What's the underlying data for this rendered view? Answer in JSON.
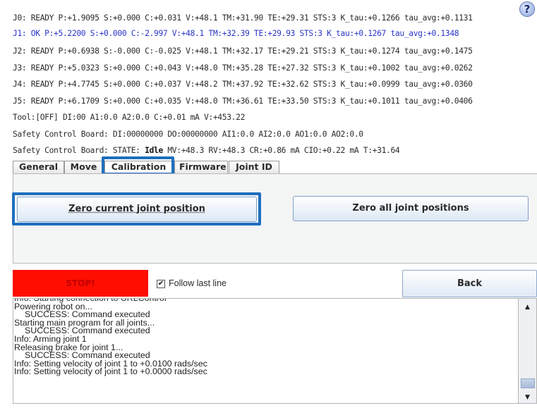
{
  "status": {
    "joints": [
      "J0: READY P:+1.9095 S:+0.000 C:+0.031 V:+48.1 TM:+31.90 TE:+29.31 STS:3 K_tau:+0.1266 tau_avg:+0.1131",
      "J1: OK P:+5.2200 S:+0.000 C:-2.997 V:+48.1 TM:+32.39 TE:+29.93 STS:3 K_tau:+0.1267 tau_avg:+0.1348",
      "J2: READY P:+0.6938 S:-0.000 C:-0.025 V:+48.1 TM:+32.17 TE:+29.21 STS:3 K_tau:+0.1274 tau_avg:+0.1475",
      "J3: READY P:+5.0323 S:+0.000 C:+0.043 V:+48.0 TM:+35.28 TE:+27.32 STS:3 K_tau:+0.1002 tau_avg:+0.0262",
      "J4: READY P:+4.7745 S:+0.000 C:+0.037 V:+48.2 TM:+37.92 TE:+32.62 STS:3 K_tau:+0.0999 tau_avg:+0.0360",
      "J5: READY P:+6.1709 S:+0.000 C:+0.035 V:+48.0 TM:+36.61 TE:+33.50 STS:3 K_tau:+0.1011 tau_avg:+0.0406"
    ],
    "tool": "Tool:[OFF] DI:00  A1:0.0 A2:0.0 C:+0.01 mA V:+453.22",
    "safety_io": "Safety Control Board: DI:00000000 DO:00000000 AI1:0.0 AI2:0.0 AO1:0.0 AO2:0.0",
    "safety_state_prefix": "Safety Control Board: STATE: ",
    "safety_state_value": "Idle",
    "safety_state_suffix": " MV:+48.3 RV:+48.3 CR:+0.86 mA CIO:+0.22 mA T:+31.64"
  },
  "help_label": "?",
  "tabs": [
    {
      "label": "General"
    },
    {
      "label": "Move"
    },
    {
      "label": "Calibration"
    },
    {
      "label": "Firmware"
    },
    {
      "label": "Joint ID"
    }
  ],
  "calibration": {
    "zero_current_label": "Zero current joint position",
    "zero_all_label": "Zero all joint positions"
  },
  "controls": {
    "stop_label": "STOP!",
    "follow_checked_glyph": "✔",
    "follow_label": "Follow last line",
    "back_label": "Back"
  },
  "log": {
    "lines": [
      {
        "text": "Info: Starting connection to URLControl",
        "indent": false
      },
      {
        "text": "Powering robot on...",
        "indent": false
      },
      {
        "text": "SUCCESS: Command executed",
        "indent": true
      },
      {
        "text": "Starting main program for all joints...",
        "indent": false
      },
      {
        "text": "SUCCESS: Command executed",
        "indent": true
      },
      {
        "text": "Info: Arming joint 1",
        "indent": false
      },
      {
        "text": "Releasing brake for joint 1...",
        "indent": false
      },
      {
        "text": "SUCCESS: Command executed",
        "indent": true
      },
      {
        "text": "Info: Setting velocity of joint 1 to +0.0100 rads/sec",
        "indent": false
      },
      {
        "text": "Info: Setting velocity of joint 1 to +0.0000 rads/sec",
        "indent": false
      }
    ]
  },
  "colors": {
    "highlight": "#1f6fbf",
    "stop": "#ff0d00",
    "active_joint_text": "#2a36c8"
  }
}
